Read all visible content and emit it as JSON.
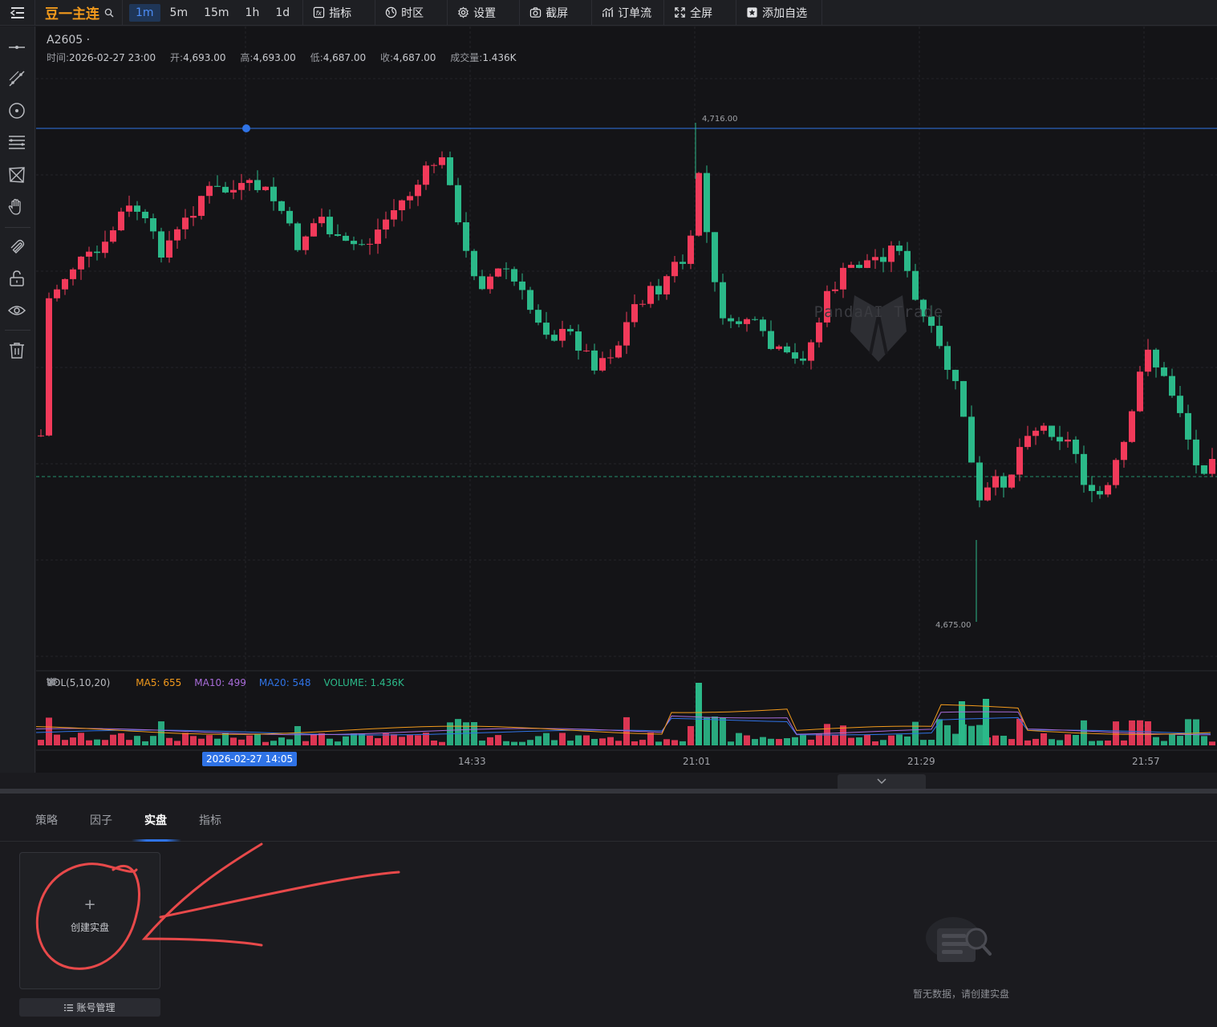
{
  "topbar": {
    "symbol": "豆一主连",
    "intervals": [
      "1m",
      "5m",
      "15m",
      "1h",
      "1d"
    ],
    "active_interval": "1m",
    "tools": {
      "indicator": "指标",
      "timezone": "时区",
      "settings": "设置",
      "screenshot": "截屏",
      "orderflow": "订单流",
      "fullscreen": "全屏",
      "watchlist": "添加自选"
    }
  },
  "left_tools": [
    "horizontal-line-icon",
    "trend-line-icon",
    "circle-icon",
    "fib-lines-icon",
    "pattern-icon",
    "hand-icon",
    "magnet-icon",
    "lock-icon",
    "eye-icon",
    "trash-icon"
  ],
  "chart": {
    "symbol_line": "A2605 ·",
    "info": {
      "time_label": "时间:",
      "time": "2026-02-27 23:00",
      "open_label": "开:",
      "open": "4,693.00",
      "high_label": "高:",
      "high": "4,693.00",
      "low_label": "低:",
      "low": "4,687.00",
      "close_label": "收:",
      "close": "4,687.00",
      "vol_label": "成交量:",
      "vol": "1.436K"
    },
    "high_marker": "4,716.00",
    "low_marker": "4,675.00",
    "watermark": "PandaAI Trade",
    "volume_panel": {
      "title": "VOL(5,10,20)",
      "ma5": "MA5: 655",
      "ma10": "MA10: 499",
      "ma20": "MA20: 548",
      "volume": "VOLUME: 1.436K"
    },
    "crosshair_date": "2026-02-27 14:05",
    "x_ticks": [
      "14:33",
      "21:01",
      "21:29",
      "21:57"
    ],
    "colors": {
      "up": "#f23a5a",
      "down": "#2bb989",
      "ma5": "#f29a1c",
      "ma10": "#a86cd9",
      "ma20": "#2f73e6",
      "volume": "#2bb989"
    }
  },
  "bottom": {
    "tabs": [
      "策略",
      "因子",
      "实盘",
      "指标"
    ],
    "active_tab": "实盘",
    "create_plus": "+",
    "create_label": "创建实盘",
    "account_button": "账号管理",
    "empty_text": "暂无数据，请创建实盘"
  }
}
